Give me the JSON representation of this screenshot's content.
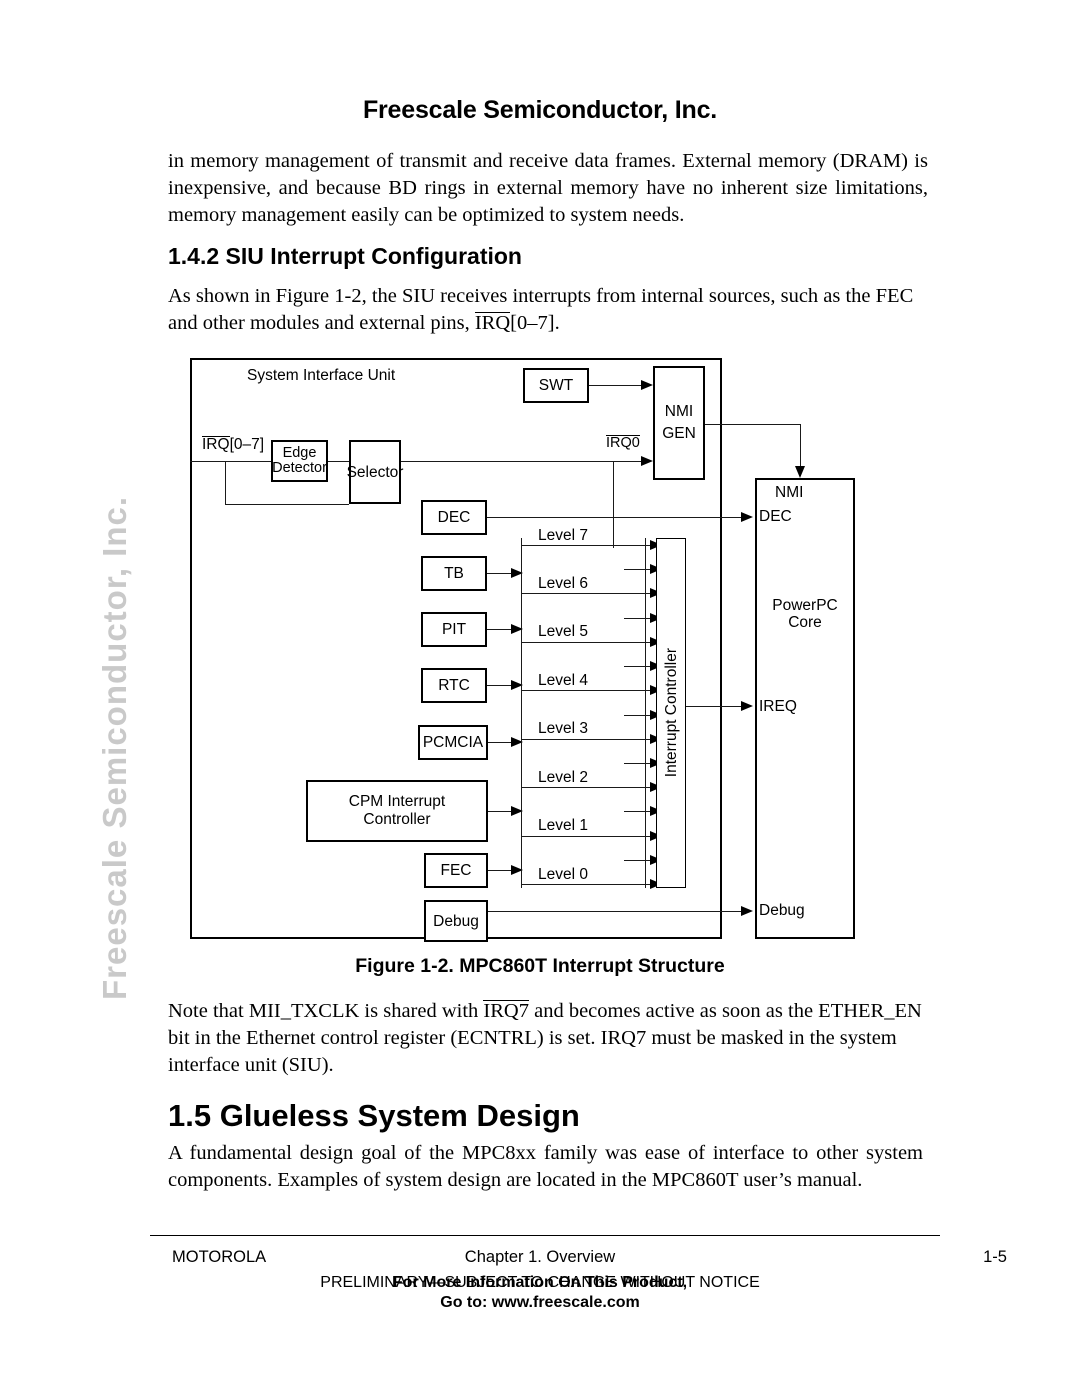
{
  "watermark": {
    "text": "Freescale Semiconductor, Inc."
  },
  "header": {
    "title": "Freescale Semiconductor, Inc."
  },
  "body": {
    "intro_paragraph": "in memory management of transmit and receive data frames. External memory (DRAM) is inexpensive, and because BD rings in external memory have no inherent size limitations, memory management easily can be optimized to system needs.",
    "section_142_heading": "1.4.2  SIU Interrupt Configuration",
    "section_142_para_a": "As shown in Figure 1-2, the SIU receives interrupts from internal sources, such as the FEC and other modules and external pins, ",
    "section_142_para_irq": "IRQ",
    "section_142_para_b": "[0–7].",
    "note_a": "Note that MII_TXCLK is shared with ",
    "note_irq": "IRQ7",
    "note_b": " and becomes active as soon as the ETHER_EN bit in the Ethernet control register (ECNTRL) is set. IRQ7 must be masked in the system interface unit (SIU).",
    "section_15_heading": "1.5  Glueless System Design",
    "section_15_para": "A fundamental design goal of the MPC8xx family was ease of interface to other system components. Examples of system design are located in the MPC860T user’s manual."
  },
  "figure": {
    "caption": "Figure 1-2. MPC860T Interrupt Structure",
    "siu_label": "System Interface Unit",
    "irq_bus_label_base": "IRQ",
    "irq_bus_label_rest": "[0–7]",
    "irq0_label": "IRQ0",
    "blocks": {
      "edge_detector": "Edge\nDetector",
      "edge_detector_l1": "Edge",
      "edge_detector_l2": "Detector",
      "selector": "Selector",
      "swt": "SWT",
      "nmi_gen_l1": "NMI",
      "nmi_gen_l2": "GEN",
      "dec": "DEC",
      "tb": "TB",
      "pit": "PIT",
      "rtc": "RTC",
      "pcmcia": "PCMCIA",
      "cpm_l1": "CPM Interrupt",
      "cpm_l2": "Controller",
      "fec": "FEC",
      "debug": "Debug",
      "interrupt_controller": "Interrupt Controller"
    },
    "levels": [
      "Level 7",
      "Level 6",
      "Level 5",
      "Level 4",
      "Level 3",
      "Level 2",
      "Level 1",
      "Level 0"
    ],
    "core": {
      "nmi_pin": "NMI",
      "dec_pin": "DEC",
      "ireq_pin": "IREQ",
      "debug_pin": "Debug",
      "name_l1": "PowerPC",
      "name_l2": "Core"
    }
  },
  "footer": {
    "left": "MOTOROLA",
    "center": "Chapter 1. Overview",
    "right": "1-5",
    "notice_preliminary": "PRELIMINARY—SUBJECT TO CHANGE WITHOUT NOTICE",
    "notice_more_info": "For More Information On This Product,",
    "notice_goto": "Go to: www.freescale.com"
  },
  "colors": {
    "text": "#000000",
    "watermark": "#c9c9c9",
    "rule": "#000000"
  }
}
